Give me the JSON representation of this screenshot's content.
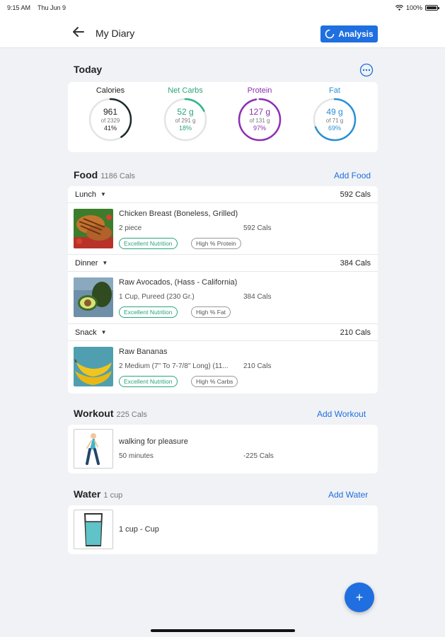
{
  "status": {
    "time": "9:15 AM",
    "date": "Thu Jun 9",
    "battery": "100%"
  },
  "nav": {
    "title": "My Diary",
    "analysis_label": "Analysis"
  },
  "today": {
    "title": "Today",
    "rings": [
      {
        "label": "Calories",
        "value": "961",
        "of": "of 2329",
        "pct": "41%",
        "fraction": 0.41,
        "color": "#1b2a2a",
        "label_color": "#222222"
      },
      {
        "label": "Net Carbs",
        "value": "52 g",
        "of": "of 291 g",
        "pct": "18%",
        "fraction": 0.18,
        "color": "#2bb58a",
        "label_color": "#2aa57a"
      },
      {
        "label": "Protein",
        "value": "127 g",
        "of": "of 131 g",
        "pct": "97%",
        "fraction": 0.97,
        "color": "#8e2fb3",
        "label_color": "#8e2fb3"
      },
      {
        "label": "Fat",
        "value": "49 g",
        "of": "of 71 g",
        "pct": "69%",
        "fraction": 0.69,
        "color": "#2a8fd6",
        "label_color": "#2a8fd6"
      }
    ]
  },
  "food": {
    "title": "Food",
    "cals": "1186 Cals",
    "add_label": "Add Food",
    "meals": [
      {
        "name": "Lunch",
        "cals": "592 Cals",
        "item": {
          "name": "Chicken Breast (Boneless, Grilled)",
          "qty": "2  piece",
          "cals": "592 Cals",
          "tags": [
            "Excellent Nutrition",
            "High % Protein"
          ]
        }
      },
      {
        "name": "Dinner",
        "cals": "384 Cals",
        "item": {
          "name": "Raw Avocados, (Hass - California)",
          "qty": "1  Cup, Pureed (230 Gr.)",
          "cals": "384 Cals",
          "tags": [
            "Excellent Nutrition",
            "High % Fat"
          ]
        }
      },
      {
        "name": "Snack",
        "cals": "210 Cals",
        "item": {
          "name": "Raw Bananas",
          "qty": "2  Medium (7\" To 7-7/8\" Long) (11...",
          "cals": "210 Cals",
          "tags": [
            "Excellent Nutrition",
            "High % Carbs"
          ]
        }
      }
    ]
  },
  "workout": {
    "title": "Workout",
    "cals": "225 Cals",
    "add_label": "Add Workout",
    "item": {
      "name": "walking for pleasure",
      "duration": "50 minutes",
      "cals": "-225 Cals"
    }
  },
  "water": {
    "title": "Water",
    "amount": "1 cup",
    "add_label": "Add Water",
    "item": {
      "name": "1 cup - Cup"
    }
  },
  "fab_label": "+"
}
